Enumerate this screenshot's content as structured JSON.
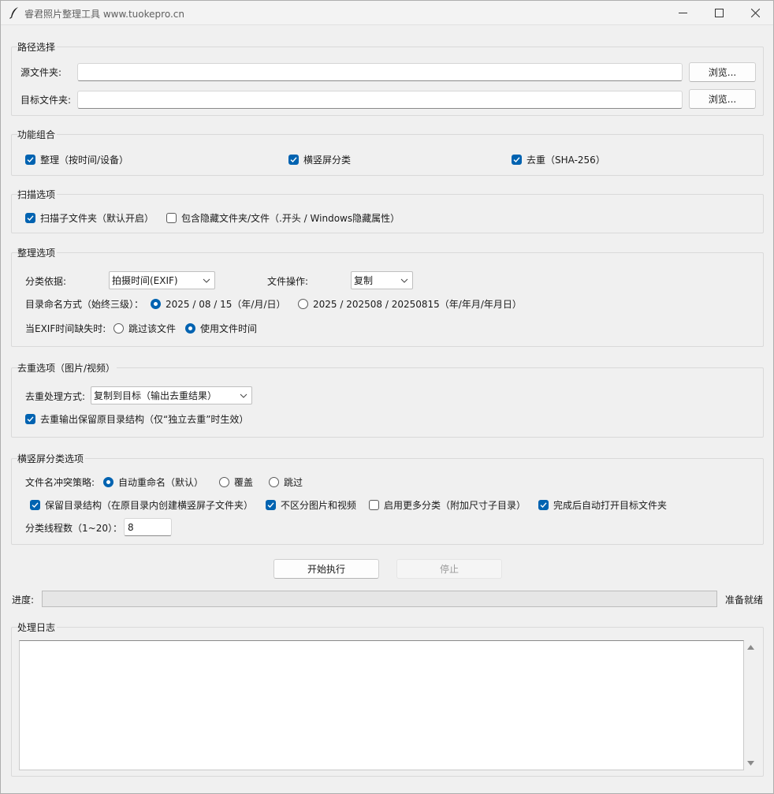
{
  "window": {
    "title": "睿君照片整理工具  www.tuokepro.cn"
  },
  "path": {
    "group_title": "路径选择",
    "source_label": "源文件夹:",
    "source_value": "",
    "target_label": "目标文件夹:",
    "target_value": "",
    "browse_label": "浏览..."
  },
  "features": {
    "group_title": "功能组合",
    "organize": {
      "label": "整理（按时间/设备）",
      "checked": true
    },
    "orientation": {
      "label": "横竖屏分类",
      "checked": true
    },
    "dedupe": {
      "label": "去重（SHA-256）",
      "checked": true
    }
  },
  "scan": {
    "group_title": "扫描选项",
    "subfolders": {
      "label": "扫描子文件夹（默认开启）",
      "checked": true
    },
    "hidden": {
      "label": "包含隐藏文件夹/文件（.开头 / Windows隐藏属性）",
      "checked": false
    }
  },
  "organize": {
    "group_title": "整理选项",
    "classify_label": "分类依据:",
    "classify_value": "拍摄时间(EXIF)",
    "file_op_label": "文件操作:",
    "file_op_value": "复制",
    "dir_naming_label": "目录命名方式（始终三级）：",
    "dir_naming_options": [
      {
        "label": "2025 / 08 / 15（年/月/日）",
        "selected": true
      },
      {
        "label": "2025 / 202508 / 20250815（年/年月/年月日）",
        "selected": false
      }
    ],
    "missing_exif_label": "当EXIF时间缺失时:",
    "missing_exif_options": [
      {
        "label": "跳过该文件",
        "selected": false
      },
      {
        "label": "使用文件时间",
        "selected": true
      }
    ]
  },
  "dedupe": {
    "group_title": "去重选项（图片/视频）",
    "mode_label": "去重处理方式:",
    "mode_value": "复制到目标（输出去重结果）",
    "keep_structure": {
      "label": "去重输出保留原目录结构（仅“独立去重”时生效）",
      "checked": true
    }
  },
  "orientation": {
    "group_title": "横竖屏分类选项",
    "conflict_label": "文件名冲突策略:",
    "conflict_options": [
      {
        "label": "自动重命名（默认）",
        "selected": true
      },
      {
        "label": "覆盖",
        "selected": false
      },
      {
        "label": "跳过",
        "selected": false
      }
    ],
    "keep_dir": {
      "label": "保留目录结构（在原目录内创建横竖屏子文件夹）",
      "checked": true
    },
    "no_split": {
      "label": "不区分图片和视频",
      "checked": true
    },
    "more_classes": {
      "label": "启用更多分类（附加尺寸子目录）",
      "checked": false
    },
    "auto_open": {
      "label": "完成后自动打开目标文件夹",
      "checked": true
    },
    "threads_label": "分类线程数（1~20）：",
    "threads_value": "8"
  },
  "actions": {
    "start_label": "开始执行",
    "stop_label": "停止"
  },
  "progress": {
    "label": "进度:",
    "value": 0,
    "status": "准备就绪"
  },
  "log": {
    "group_title": "处理日志",
    "content": ""
  },
  "icons": {
    "app": "feather-quill-icon",
    "minimize": "minimize-icon",
    "maximize": "maximize-icon",
    "close": "close-icon"
  },
  "colors": {
    "accent": "#0063b1",
    "window_bg": "#f0f0f0"
  }
}
